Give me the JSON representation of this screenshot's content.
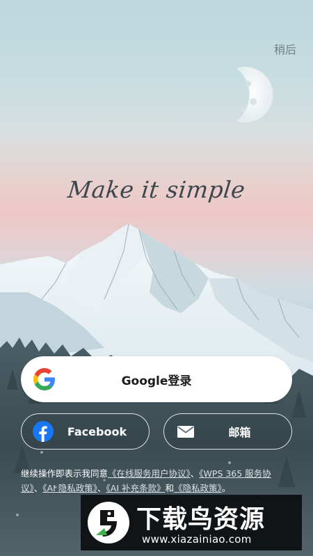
{
  "header": {
    "skip_label": "稍后"
  },
  "hero": {
    "tagline": "Make it simple"
  },
  "login": {
    "google": {
      "label": "Google登录",
      "icon": "google-icon"
    },
    "facebook": {
      "label": "Facebook",
      "icon": "facebook-icon",
      "color": "#1877f2"
    },
    "email": {
      "label": "邮箱",
      "icon": "envelope-icon"
    }
  },
  "agreement": {
    "prefix": "继续操作即表示我同意",
    "link1": "《在线服务用户协议》",
    "sep1": "、",
    "link2": "《WPS 365 服务协议》",
    "sep2": "、",
    "link3": "《AI 隐私政策》",
    "sep3": "、",
    "link4": "《AI 补充条款》",
    "and": "和",
    "link5": "《隐私政策》",
    "suffix": "。"
  },
  "watermark": {
    "title": "下载鸟资源",
    "url": "www.xiazainiao.com",
    "accent": "#3fb24a"
  }
}
